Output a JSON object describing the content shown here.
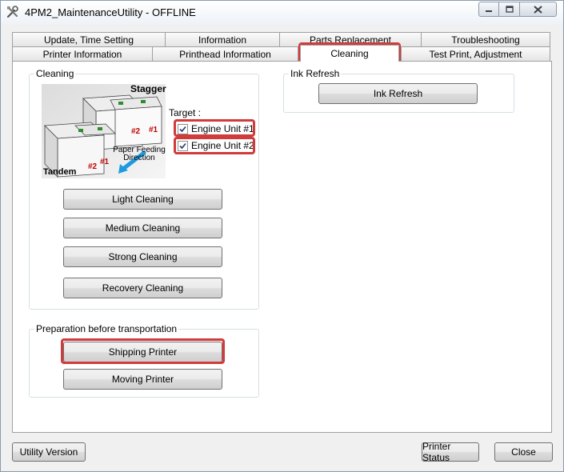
{
  "window": {
    "title": "4PM2_MaintenanceUtility - OFFLINE"
  },
  "tabs": {
    "row1": [
      {
        "label": "Update, Time Setting"
      },
      {
        "label": "Information"
      },
      {
        "label": "Parts Replacement"
      },
      {
        "label": "Troubleshooting"
      }
    ],
    "row2": [
      {
        "label": "Printer Information"
      },
      {
        "label": "Printhead Information"
      },
      {
        "label": "Cleaning",
        "selected": true
      },
      {
        "label": "Test Print, Adjustment"
      }
    ]
  },
  "cleaning_group": {
    "label": "Cleaning",
    "illustration": {
      "stagger_label": "Stagger",
      "tandem_label": "Tandem",
      "paper_direction_label": "Paper Feeding Direction",
      "unit_tags": [
        "#2",
        "#1",
        "#2",
        "#1"
      ]
    },
    "target_label": "Target :",
    "engine_units": [
      {
        "label": "Engine Unit #1",
        "checked": true
      },
      {
        "label": "Engine Unit #2",
        "checked": true
      }
    ],
    "buttons": {
      "light": "Light Cleaning",
      "medium": "Medium Cleaning",
      "strong": "Strong Cleaning",
      "recovery": "Recovery Cleaning"
    }
  },
  "ink_refresh_group": {
    "label": "Ink Refresh",
    "button": "Ink Refresh"
  },
  "transport_group": {
    "label": "Preparation before transportation",
    "shipping_button": "Shipping Printer",
    "moving_button": "Moving Printer"
  },
  "footer": {
    "utility_version": "Utility Version",
    "printer_status": "Printer Status",
    "close": "Close"
  },
  "colors": {
    "highlight": "#d23b3b",
    "arrow": "#1e9be0",
    "tag_red": "#c00000"
  }
}
